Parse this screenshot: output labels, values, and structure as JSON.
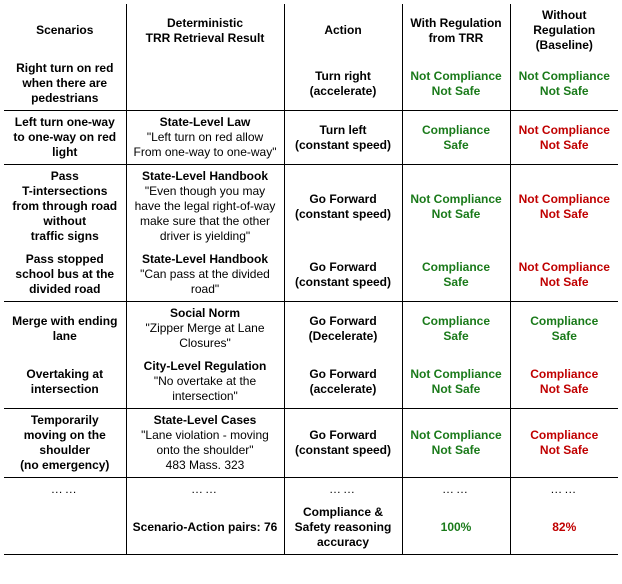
{
  "headers": {
    "scenarios": "Scenarios",
    "retrieval": "Deterministic\nTRR Retrieval Result",
    "action": "Action",
    "withreg": "With Regulation\nfrom TRR",
    "withoutreg": "Without\nRegulation\n(Baseline)"
  },
  "rows": [
    {
      "scenario": "Right turn on red when there are pedestrians",
      "retr_title": "",
      "retr_detail": "",
      "action": "Turn right\n(accelerate)",
      "with": {
        "text": "Not Compliance\nNot Safe",
        "cls": "green"
      },
      "without": {
        "text": "Not Compliance\nNot Safe",
        "cls": "green"
      }
    },
    {
      "scenario": "Left turn one-way to one-way on red light",
      "retr_title": "State-Level Law",
      "retr_detail": "\"Left turn on red allow\nFrom one-way to one-way\"",
      "action": "Turn left\n(constant speed)",
      "with": {
        "text": "Compliance\nSafe",
        "cls": "green"
      },
      "without": {
        "text": "Not Compliance\nNot Safe",
        "cls": "red"
      }
    },
    {
      "scenario": "Pass\nT-intersections\nfrom through road\nwithout\ntraffic signs",
      "retr_title": "State-Level Handbook",
      "retr_detail": "\"Even though you may have the legal right-of-way make sure that the other driver is yielding\"",
      "action": "Go Forward\n(constant speed)",
      "with": {
        "text": "Not Compliance\nNot Safe",
        "cls": "green"
      },
      "without": {
        "text": "Not Compliance\nNot Safe",
        "cls": "red"
      }
    },
    {
      "scenario": "Pass stopped school bus at the divided road",
      "retr_title": "State-Level Handbook",
      "retr_detail": "\"Can pass at the divided road\"",
      "action": "Go Forward\n(constant speed)",
      "with": {
        "text": "Compliance\nSafe",
        "cls": "green"
      },
      "without": {
        "text": "Not Compliance\nNot Safe",
        "cls": "red"
      }
    },
    {
      "scenario": "Merge with ending lane",
      "retr_title": "Social Norm",
      "retr_detail": "\"Zipper Merge at Lane Closures\"",
      "action": "Go Forward\n(Decelerate)",
      "with": {
        "text": "Compliance\nSafe",
        "cls": "green"
      },
      "without": {
        "text": "Compliance\nSafe",
        "cls": "green"
      }
    },
    {
      "scenario": "Overtaking at intersection",
      "retr_title": "City-Level Regulation",
      "retr_detail": "\"No overtake at the intersection\"",
      "action": "Go Forward\n(accelerate)",
      "with": {
        "text": "Not Compliance\nNot Safe",
        "cls": "green"
      },
      "without": {
        "text": "Compliance\nNot Safe",
        "cls": "red"
      }
    },
    {
      "scenario": "Temporarily moving on the shoulder\n(no emergency)",
      "retr_title": "State-Level Cases",
      "retr_detail": "\"Lane violation - moving onto the shoulder\"\n483 Mass. 323",
      "action": "Go Forward\n(constant speed)",
      "with": {
        "text": "Not Compliance\nNot Safe",
        "cls": "green"
      },
      "without": {
        "text": "Compliance\nNot Safe",
        "cls": "red"
      }
    }
  ],
  "ellipsis": "……",
  "summary": {
    "pairs_label": "Scenario-Action pairs: 76",
    "accuracy_label": "Compliance & Safety reasoning accuracy",
    "with": "100%",
    "without": "82%"
  }
}
